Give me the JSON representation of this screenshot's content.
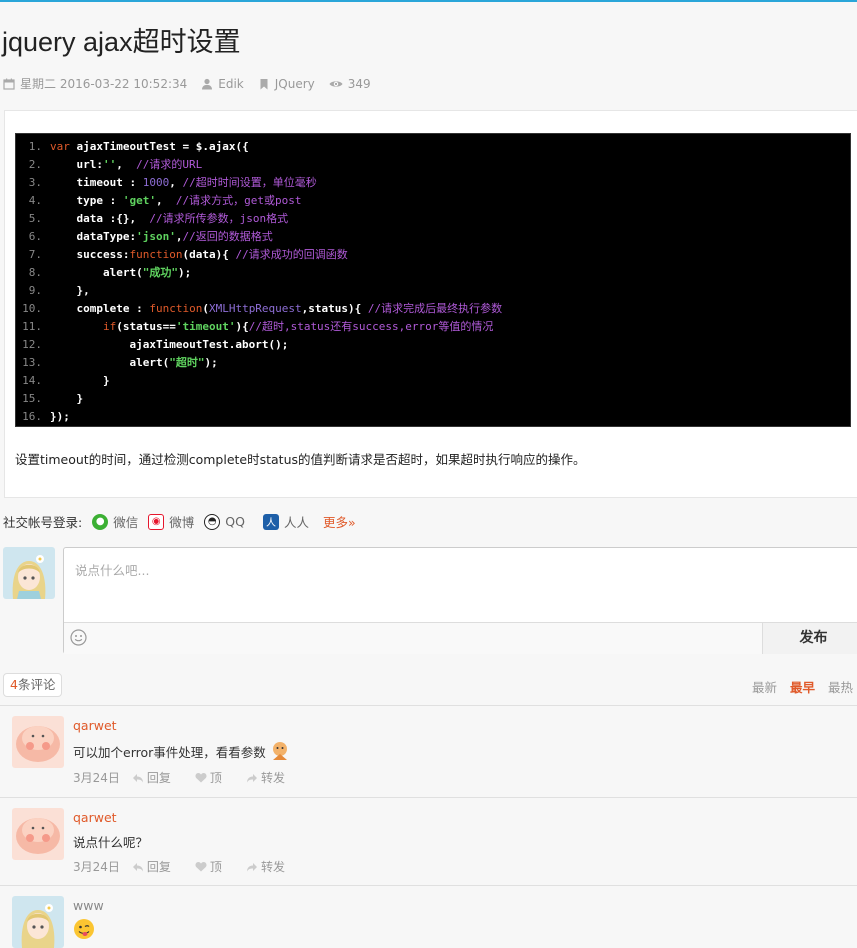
{
  "article": {
    "title": "jquery ajax超时设置",
    "meta": {
      "date": "星期二 2016-03-22 10:52:34",
      "author": "Edik",
      "category": "JQuery",
      "views": "349"
    },
    "code_lines": [
      {
        "n": "1.",
        "parts": [
          {
            "t": "kw",
            "v": "var "
          },
          {
            "t": "tx",
            "v": "ajaxTimeoutTest = $.ajax({"
          }
        ]
      },
      {
        "n": "2.",
        "parts": [
          {
            "t": "tx",
            "v": "    url:"
          },
          {
            "t": "str",
            "v": "''"
          },
          {
            "t": "tx",
            "v": ",  "
          },
          {
            "t": "cm",
            "v": "//请求的URL"
          }
        ]
      },
      {
        "n": "3.",
        "parts": [
          {
            "t": "tx",
            "v": "    timeout : "
          },
          {
            "t": "num",
            "v": "1000"
          },
          {
            "t": "tx",
            "v": ", "
          },
          {
            "t": "cm",
            "v": "//超时时间设置，单位毫秒"
          }
        ]
      },
      {
        "n": "4.",
        "parts": [
          {
            "t": "tx",
            "v": "    type : "
          },
          {
            "t": "str",
            "v": "'get'"
          },
          {
            "t": "tx",
            "v": ",  "
          },
          {
            "t": "cm",
            "v": "//请求方式，get或post"
          }
        ]
      },
      {
        "n": "5.",
        "parts": [
          {
            "t": "tx",
            "v": "    data :{},  "
          },
          {
            "t": "cm",
            "v": "//请求所传参数，json格式"
          }
        ]
      },
      {
        "n": "6.",
        "parts": [
          {
            "t": "tx",
            "v": "    dataType:"
          },
          {
            "t": "str",
            "v": "'json'"
          },
          {
            "t": "tx",
            "v": ","
          },
          {
            "t": "cm",
            "v": "//返回的数据格式"
          }
        ]
      },
      {
        "n": "7.",
        "parts": [
          {
            "t": "tx",
            "v": "    success:"
          },
          {
            "t": "kw",
            "v": "function"
          },
          {
            "t": "tx",
            "v": "(data){ "
          },
          {
            "t": "cm",
            "v": "//请求成功的回调函数"
          }
        ]
      },
      {
        "n": "8.",
        "parts": [
          {
            "t": "tx",
            "v": "        alert("
          },
          {
            "t": "str",
            "v": "\"成功\""
          },
          {
            "t": "tx",
            "v": ");"
          }
        ]
      },
      {
        "n": "9.",
        "parts": [
          {
            "t": "tx",
            "v": "    },"
          }
        ]
      },
      {
        "n": "10.",
        "parts": [
          {
            "t": "tx",
            "v": "    complete : "
          },
          {
            "t": "kw",
            "v": "function"
          },
          {
            "t": "tx",
            "v": "("
          },
          {
            "t": "num",
            "v": "XMLHttpRequest"
          },
          {
            "t": "tx",
            "v": ",status){ "
          },
          {
            "t": "cm",
            "v": "//请求完成后最终执行参数"
          }
        ]
      },
      {
        "n": "11.",
        "parts": [
          {
            "t": "kw",
            "v": "        if"
          },
          {
            "t": "tx",
            "v": "(status=="
          },
          {
            "t": "str",
            "v": "'timeout'"
          },
          {
            "t": "tx",
            "v": "){"
          },
          {
            "t": "cm",
            "v": "//超时,status还有success,error等值的情况"
          }
        ]
      },
      {
        "n": "12.",
        "parts": [
          {
            "t": "tx",
            "v": "            ajaxTimeoutTest.abort();"
          }
        ]
      },
      {
        "n": "13.",
        "parts": [
          {
            "t": "tx",
            "v": "            alert("
          },
          {
            "t": "str",
            "v": "\"超时\""
          },
          {
            "t": "tx",
            "v": ");"
          }
        ]
      },
      {
        "n": "14.",
        "parts": [
          {
            "t": "tx",
            "v": "        }"
          }
        ]
      },
      {
        "n": "15.",
        "parts": [
          {
            "t": "tx",
            "v": "    }"
          }
        ]
      },
      {
        "n": "16.",
        "parts": [
          {
            "t": "tx",
            "v": "});"
          }
        ]
      }
    ],
    "description": "设置timeout的时间，通过检测complete时status的值判断请求是否超时，如果超时执行响应的操作。"
  },
  "social": {
    "label": "社交帐号登录:",
    "options": [
      "微信",
      "微博",
      "QQ",
      "人人"
    ],
    "more": "更多»"
  },
  "comment_box": {
    "placeholder": "说点什么吧...",
    "publish": "发布"
  },
  "comments_header": {
    "count": "4",
    "count_suffix": "条评论",
    "sort": [
      "最新",
      "最早",
      "最热"
    ],
    "active_sort": "最早"
  },
  "comments": [
    {
      "name": "qarwet",
      "text": "可以加个error事件处理，看看参数",
      "date": "3月24日",
      "reply": "回复",
      "like": "顶",
      "share": "转发"
    },
    {
      "name": "qarwet",
      "text": "说点什么呢？",
      "date": "3月24日",
      "reply": "回复",
      "like": "顶",
      "share": "转发"
    },
    {
      "name": "www",
      "text": "",
      "date": "",
      "reply": "",
      "like": "",
      "share": ""
    }
  ],
  "colors": {
    "accent": "#e05a2a",
    "link": "#2aa6d9"
  }
}
